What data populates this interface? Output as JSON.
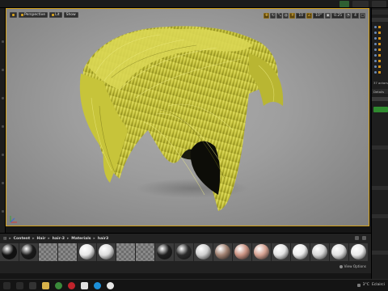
{
  "viewport": {
    "perspective_label": "Perspective",
    "lit_label": "Lit",
    "show_label": "Show",
    "grid_value": "10",
    "angle_value": "10°",
    "scale_value": "0.25",
    "speed_value": "4"
  },
  "content_browser": {
    "breadcrumbs": [
      "Content",
      "Hair",
      "hair-3",
      "Materials",
      "hair3"
    ],
    "view_options_label": "View Options",
    "thumbnails": [
      {
        "kind": "ball",
        "color": "#111111"
      },
      {
        "kind": "ball",
        "color": "#1a1a1a"
      },
      {
        "kind": "check"
      },
      {
        "kind": "check"
      },
      {
        "kind": "ball",
        "color": "#e6e6e6"
      },
      {
        "kind": "ball",
        "color": "#dcdcdc"
      },
      {
        "kind": "check"
      },
      {
        "kind": "check"
      },
      {
        "kind": "ball",
        "color": "#1e1e1e"
      },
      {
        "kind": "ball",
        "color": "#2a2a2a"
      },
      {
        "kind": "ball",
        "color": "#cfcfcf"
      },
      {
        "kind": "ball",
        "color": "#a08070"
      },
      {
        "kind": "ball",
        "color": "#c89080"
      },
      {
        "kind": "ball",
        "color": "#d4a090"
      },
      {
        "kind": "ball",
        "color": "#e4e4e4"
      },
      {
        "kind": "ball",
        "color": "#ececec"
      },
      {
        "kind": "ball",
        "color": "#d8d8d8"
      },
      {
        "kind": "ball",
        "color": "#e0e0e0"
      },
      {
        "kind": "ball",
        "color": "#eaeaea"
      }
    ]
  },
  "right_panel": {
    "items_count": "37 actors",
    "details_label": "Details"
  },
  "taskbar": {
    "tray_label": "3°C",
    "clock": "Eclairci"
  },
  "colors": {
    "accent": "#d2a11b",
    "hair": "#c4c23a",
    "hair_dark": "#8e8c1c",
    "hair_light": "#e8e56a"
  }
}
